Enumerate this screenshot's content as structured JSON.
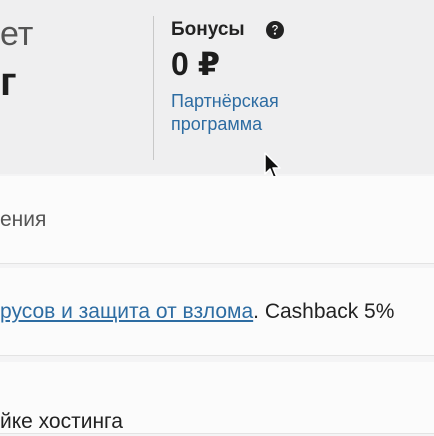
{
  "account_panel": {
    "heading_fragment": "ет",
    "value_fragment": "г"
  },
  "bonus": {
    "title": "Бонусы",
    "amount": "0 ₽",
    "partner_link": "Партнёрская программа"
  },
  "rows": {
    "row1_text": "ения",
    "row2_link": "русов и защита от взлома",
    "row2_after": ". Cashback 5%",
    "row3_text": "йке хостинга"
  }
}
